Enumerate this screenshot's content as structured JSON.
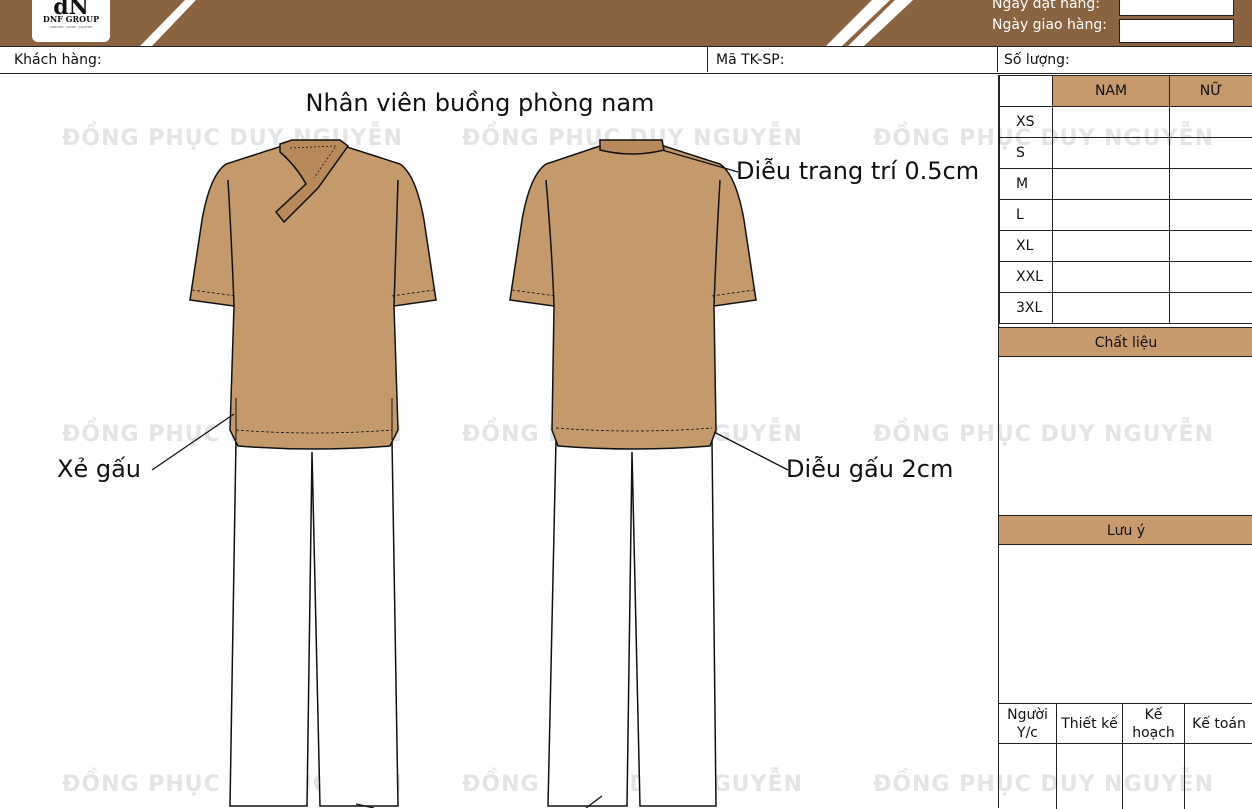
{
  "header": {
    "logo_mark": "dN",
    "logo_name": "DNF GROUP",
    "logo_tagline": "UNIFORM · WORK · CLOTHES",
    "order_date_label": "Ngày đặt hàng:",
    "delivery_date_label": "Ngày giao hàng:",
    "order_date_value": "",
    "delivery_date_value": ""
  },
  "info": {
    "customer_label": "Khách hàng:",
    "code_label": "Mã TK-SP:",
    "quantity_label": "Số lượng:"
  },
  "sizes": {
    "col_male": "NAM",
    "col_female": "NỮ",
    "rows": [
      "XS",
      "S",
      "M",
      "L",
      "XL",
      "XXL",
      "3XL"
    ]
  },
  "material_label": "Chất liệu",
  "notes_label": "Lưu ý",
  "signatures": [
    "Người Y/c",
    "Thiết kế",
    "Kế hoạch",
    "Kế toán"
  ],
  "design": {
    "title": "Nhân viên buồng phòng nam",
    "callout_collar": "Diễu trang trí 0.5cm",
    "callout_slit": "Xẻ gấu",
    "callout_hem": "Diễu gấu 2cm",
    "watermark": "ĐỒNG PHỤC DUY NGUYỄN",
    "shirt_color": "#c49a6c",
    "collar_color": "#b8895b",
    "pants_color": "#ffffff"
  }
}
